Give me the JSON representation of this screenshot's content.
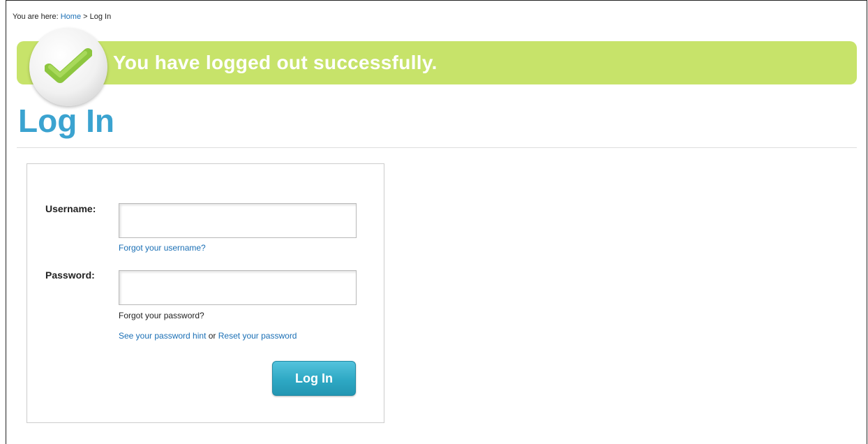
{
  "breadcrumb": {
    "prefix": "You are here:",
    "home": "Home",
    "separator": ">",
    "current": "Log In"
  },
  "banner": {
    "message": "You have logged out successfully.",
    "icon": "check-icon",
    "color": "#c7e36a"
  },
  "page": {
    "title": "Log In",
    "title_color": "#3ba3d0"
  },
  "form": {
    "username_label": "Username:",
    "username_value": "",
    "forgot_username": "Forgot your username?",
    "password_label": "Password:",
    "password_value": "",
    "forgot_password": "Forgot your password?",
    "hint_link": "See your password hint",
    "or_text": "or",
    "reset_link": "Reset your password",
    "submit_label": "Log In"
  },
  "colors": {
    "link": "#1a6fb5",
    "button": "#2ea8c4"
  }
}
